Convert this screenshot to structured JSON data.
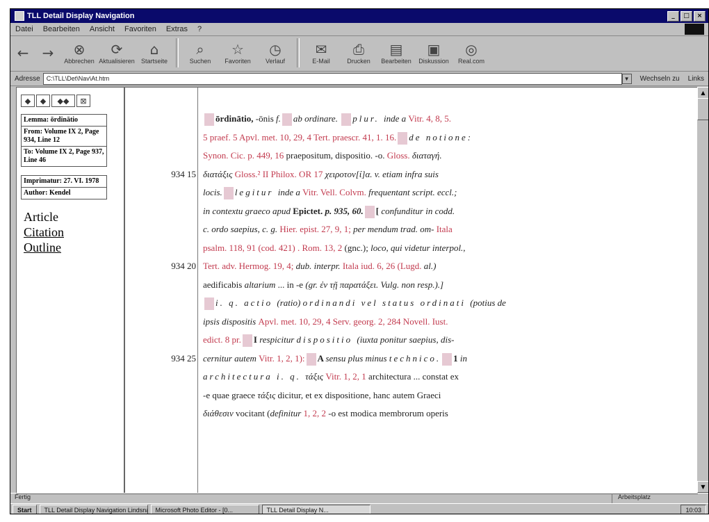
{
  "window": {
    "title": "TLL Detail Display Navigation"
  },
  "menu": [
    "Datei",
    "Bearbeiten",
    "Ansicht",
    "Favoriten",
    "Extras",
    "?"
  ],
  "toolbar": {
    "buttons": [
      {
        "label": "",
        "icon": "back-icon"
      },
      {
        "label": "",
        "icon": "forward-icon"
      },
      {
        "label": "Abbrechen",
        "icon": "stop-icon"
      },
      {
        "label": "Aktualisieren",
        "icon": "refresh-icon"
      },
      {
        "label": "Startseite",
        "icon": "home-icon"
      },
      {
        "label": "Suchen",
        "icon": "search-icon"
      },
      {
        "label": "Favoriten",
        "icon": "favorites-icon"
      },
      {
        "label": "Verlauf",
        "icon": "history-icon"
      },
      {
        "label": "E-Mail",
        "icon": "mail-icon"
      },
      {
        "label": "Drucken",
        "icon": "print-icon"
      },
      {
        "label": "Bearbeiten",
        "icon": "edit-icon"
      },
      {
        "label": "Diskussion",
        "icon": "discuss-icon"
      },
      {
        "label": "Real.com",
        "icon": "real-icon"
      }
    ]
  },
  "address": {
    "label": "Adresse",
    "value": "C:\\TLL\\Det\\Nav\\At.htm",
    "go": "Wechseln zu",
    "links": "Links"
  },
  "sidebar": {
    "nav_icons": [
      "◆",
      "◆",
      "◆◆",
      "⊠"
    ],
    "lemma": "Lemma: ōrdinātio",
    "from": "From: Volume IX 2, Page 934, Line 12",
    "to": "To: Volume IX 2, Page 937, Line 46",
    "imprimatur": "Imprimatur: 27. VI. 1978",
    "author": "Author: Kendel",
    "article": "Article",
    "citation": "Citation",
    "outline": "Outline"
  },
  "lines": [
    {
      "num": "",
      "parts": [
        {
          "t": "mk"
        },
        {
          "t": "b",
          "v": "ōrdinātio, "
        },
        {
          "t": "n",
          "v": "-ōnis "
        },
        {
          "t": "it",
          "v": "f."
        },
        {
          "t": "mk"
        },
        {
          "t": "it",
          "v": "ab ordinare. "
        },
        {
          "t": "mk"
        },
        {
          "t": "it sp",
          "v": "plur. "
        },
        {
          "t": "it",
          "v": "inde a "
        },
        {
          "t": "red",
          "v": "Vitr. 4, 8, 5."
        }
      ]
    },
    {
      "num": "",
      "parts": [
        {
          "t": "red",
          "v": "5 praef. 5 Apvl. met. 10, 29, 4 Tert. praescr. 41, 1. 16."
        },
        {
          "t": "mk"
        },
        {
          "t": "it sp",
          "v": "de notione:"
        }
      ]
    },
    {
      "num": "",
      "parts": [
        {
          "t": "red",
          "v": "Synon. Cic. p. 449, 16 "
        },
        {
          "t": "n",
          "v": "praepositum, dispositio. -o. "
        },
        {
          "t": "red",
          "v": "Gloss. "
        },
        {
          "t": "it",
          "v": "διαταγή."
        }
      ]
    },
    {
      "num": "934 15",
      "parts": [
        {
          "t": "it",
          "v": "διατάξις "
        },
        {
          "t": "red",
          "v": "Gloss.² II Philox. OR 17 "
        },
        {
          "t": "it",
          "v": "χειροτον[ί]α. v. etiam infra suis"
        }
      ]
    },
    {
      "num": "",
      "parts": [
        {
          "t": "it",
          "v": "locis."
        },
        {
          "t": "mk"
        },
        {
          "t": "it sp",
          "v": "legitur "
        },
        {
          "t": "it",
          "v": "inde a "
        },
        {
          "t": "red",
          "v": "Vitr.  Vell.  Colvm. "
        },
        {
          "t": "it",
          "v": " frequentant script. eccl.;"
        }
      ]
    },
    {
      "num": "",
      "parts": [
        {
          "t": "it",
          "v": "in contextu graeco apud "
        },
        {
          "t": "b",
          "v": "Epictet. "
        },
        {
          "t": "it b",
          "v": "p. 935, 60."
        },
        {
          "t": "mk"
        },
        {
          "t": "b",
          "v": "[ "
        },
        {
          "t": "it",
          "v": "confunditur in codd."
        }
      ]
    },
    {
      "num": "",
      "parts": [
        {
          "t": "it",
          "v": "c. ordo saepius, c. g. "
        },
        {
          "t": "red",
          "v": "Hier. epist. 27, 9, 1; "
        },
        {
          "t": "it",
          "v": "per mendum trad. om- "
        },
        {
          "t": "red",
          "v": "Itala"
        }
      ]
    },
    {
      "num": "",
      "parts": [
        {
          "t": "red",
          "v": "psalm. 118, 91 (cod. 421) . Rom. 13, 2 "
        },
        {
          "t": "n",
          "v": "(gnc.); "
        },
        {
          "t": "it",
          "v": "loco, qui videtur interpol.,"
        }
      ]
    },
    {
      "num": "934 20",
      "parts": [
        {
          "t": "red",
          "v": "Tert. adv. Hermog. 19, 4; "
        },
        {
          "t": "it",
          "v": "dub. interpr. "
        },
        {
          "t": "red",
          "v": "Itala iud. 6, 26 (Lugd. "
        },
        {
          "t": "it",
          "v": "al.)"
        }
      ]
    },
    {
      "num": "",
      "parts": [
        {
          "t": "n",
          "v": "aedificabis "
        },
        {
          "t": "it",
          "v": "altarium "
        },
        {
          "t": "n",
          "v": "... in -e "
        },
        {
          "t": "it",
          "v": "(gr. ἐν τῇ παρατάξει. Vulg. non resp.).]"
        }
      ]
    },
    {
      "num": "",
      "parts": [
        {
          "t": "mk"
        },
        {
          "t": "it sp",
          "v": "i. q. actio "
        },
        {
          "t": "it",
          "v": "(ratio) "
        },
        {
          "t": "it sp",
          "v": "ordinandi vel status ordinati "
        },
        {
          "t": "it",
          "v": "(potius de"
        }
      ]
    },
    {
      "num": "",
      "parts": [
        {
          "t": "it",
          "v": "ipsis dispositis "
        },
        {
          "t": "red",
          "v": "Apvl. met. 10, 29, 4 Serv. georg. 2, 284 Novell. Iust."
        }
      ]
    },
    {
      "num": "",
      "parts": [
        {
          "t": "red",
          "v": "edict. 8 pr."
        },
        {
          "t": "mk"
        },
        {
          "t": "b",
          "v": "I "
        },
        {
          "t": "it",
          "v": "respicitur "
        },
        {
          "t": "it sp",
          "v": "dispositio "
        },
        {
          "t": "it",
          "v": "(iuxta ponitur saepius, dis-"
        }
      ]
    },
    {
      "num": "934 25",
      "parts": [
        {
          "t": "it",
          "v": "cernitur autem "
        },
        {
          "t": "red",
          "v": "Vitr. 1, 2, 1):"
        },
        {
          "t": "mk"
        },
        {
          "t": "b",
          "v": "A "
        },
        {
          "t": "it",
          "v": "sensu plus minus "
        },
        {
          "t": "it sp",
          "v": "technico."
        },
        {
          "t": "mk"
        },
        {
          "t": "b",
          "v": "1 "
        },
        {
          "t": "it",
          "v": "in"
        }
      ]
    },
    {
      "num": "",
      "parts": [
        {
          "t": "it sp",
          "v": "architectura i. q. "
        },
        {
          "t": "it",
          "v": "τάξις "
        },
        {
          "t": "red",
          "v": "Vitr. 1, 2, 1 "
        },
        {
          "t": "n",
          "v": "architectura ... constat ex"
        }
      ]
    },
    {
      "num": "",
      "parts": [
        {
          "t": "n",
          "v": "-e quae graece "
        },
        {
          "t": "it",
          "v": "τάξις "
        },
        {
          "t": "n",
          "v": "dicitur, et ex dispositione, hanc autem Graeci"
        }
      ]
    },
    {
      "num": "",
      "parts": [
        {
          "t": "it",
          "v": "διάθεσιν "
        },
        {
          "t": "n",
          "v": "vocitant ("
        },
        {
          "t": "it",
          "v": "definitur "
        },
        {
          "t": "red",
          "v": "1, 2, 2 "
        },
        {
          "t": "n",
          "v": "-o est modica membrorum operis"
        }
      ]
    }
  ],
  "status": {
    "left": "Fertig",
    "right": "Arbeitsplatz"
  },
  "taskbar": {
    "start": "Start",
    "tasks": [
      "TLL Detail Display Navigation Lindsnail L...",
      "Microsoft Photo Editor - [0...",
      "TLL Detail Display N..."
    ],
    "clock": "10:03"
  }
}
